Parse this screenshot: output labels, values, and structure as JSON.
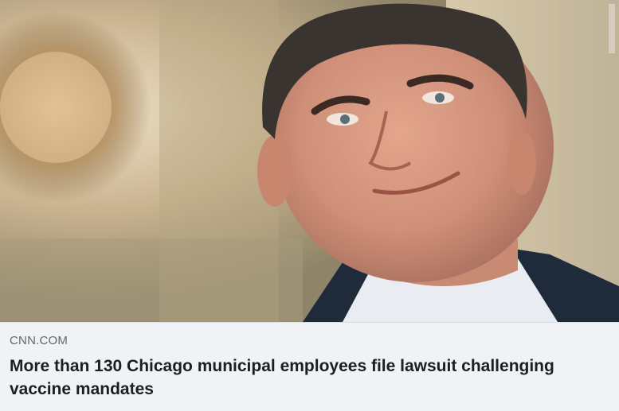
{
  "link_card": {
    "image_alt": "",
    "image_description_icon": "person-portrait-photo",
    "source_domain": "CNN.COM",
    "headline": "More than 130 Chicago municipal employees file lawsuit challenging vaccine mandates"
  },
  "colors": {
    "caption_bg": "#f0f2f5",
    "domain_text": "#606770",
    "headline_text": "#1c1e21"
  }
}
